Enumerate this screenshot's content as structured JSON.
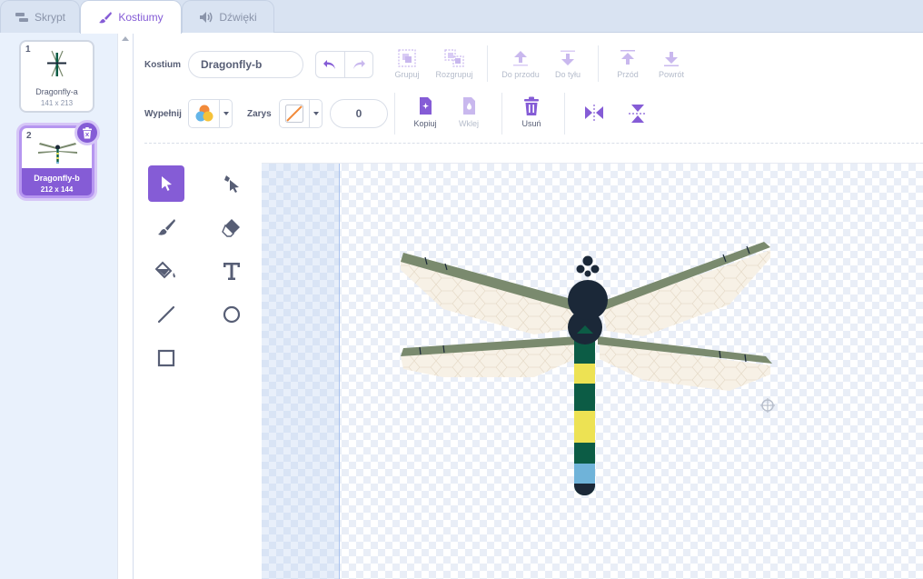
{
  "tabs": [
    {
      "label": "Skrypt",
      "icon": "code-icon",
      "active": false
    },
    {
      "label": "Kostiumy",
      "icon": "paintbrush-icon",
      "active": true
    },
    {
      "label": "Dźwięki",
      "icon": "speaker-icon",
      "active": false
    }
  ],
  "costumes": [
    {
      "number": "1",
      "name": "Dragonfly-a",
      "size": "141 x 213",
      "selected": false
    },
    {
      "number": "2",
      "name": "Dragonfly-b",
      "size": "212 x 144",
      "selected": true
    }
  ],
  "toolbar": {
    "costume_label": "Kostium",
    "costume_name": "Dragonfly-b",
    "group": "Grupuj",
    "ungroup": "Rozgrupuj",
    "forward": "Do przodu",
    "backward": "Do tyłu",
    "front": "Przód",
    "back": "Powrót",
    "fill_label": "Wypełnij",
    "outline_label": "Zarys",
    "outline_width": "0",
    "copy": "Kopiuj",
    "paste": "Wklej",
    "delete": "Usuń"
  },
  "colors": {
    "accent": "#855cd6",
    "wing_vein": "#7a8a6e",
    "wing_fill": "#f7f1e6",
    "body_dark": "#1b2838",
    "body_green": "#0c5c45",
    "body_yellow": "#ede253",
    "tail_blue": "#6fb3d9"
  }
}
